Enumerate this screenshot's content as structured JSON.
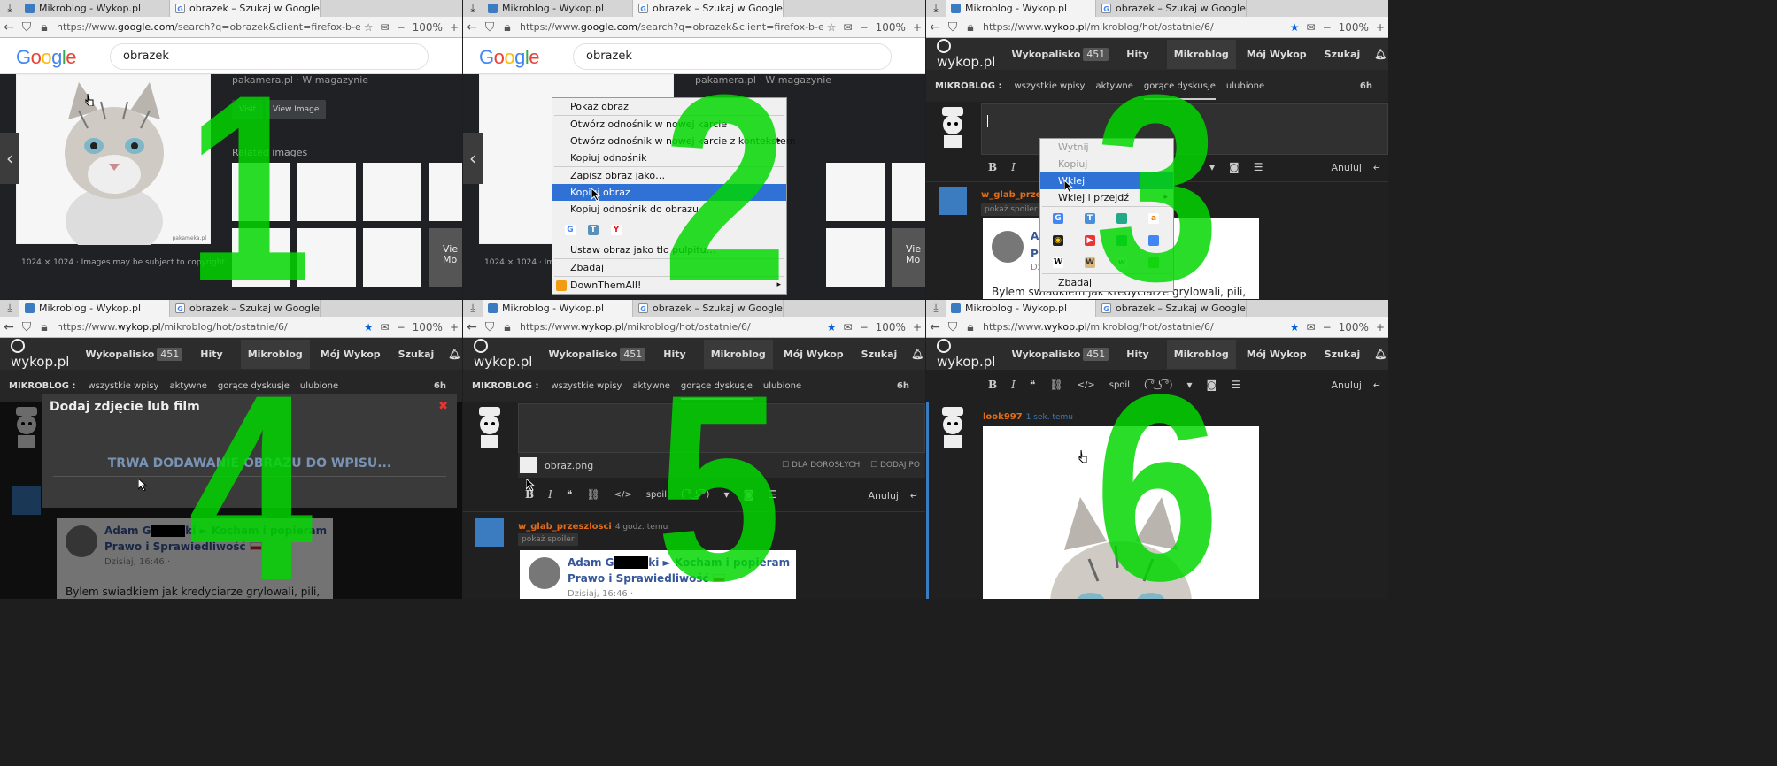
{
  "browser": {
    "tab_wykop": "Mikroblog - Wykop.pl",
    "tab_google": "obrazek – Szukaj w Google",
    "zoom": "100%",
    "url_google_prefix": "https://www.",
    "url_google_host": "google.com",
    "url_google_rest": "/search?q=obrazek&client=firefox-b-e&s",
    "url_wykop_prefix": "https://www.",
    "url_wykop_host": "wykop.pl",
    "url_wykop_rest": "/mikroblog/hot/ostatnie/6/"
  },
  "step_numbers": [
    "1",
    "2",
    "3",
    "4",
    "5",
    "6"
  ],
  "google": {
    "logo": "Google",
    "query": "obrazek",
    "source": "pakamera.pl · W magazynie",
    "visit": "Visit",
    "view_image": "View Image",
    "related": "Related images",
    "caption": "1024 × 1024 · Images may be subject to copyright.",
    "more_a": "Vie",
    "more_b": "Mo",
    "watermark": "pakameka.pl"
  },
  "context_menu_2": {
    "items": [
      "Pokaż obraz",
      "Otwórz odnośnik w nowej karcie",
      "Otwórz odnośnik w nowej karcie z kontekstem",
      "Kopiuj odnośnik",
      "Zapisz obraz jako…",
      "Kopiuj obraz",
      "Kopiuj odnośnik do obrazu",
      "Ustaw obraz jako tło pulpitu…",
      "Zbadaj",
      "DownThemAll!"
    ]
  },
  "context_menu_3": {
    "items": [
      "Wytnij",
      "Kopiuj",
      "Wklej",
      "Wklej i przejdź",
      "Zbadaj"
    ]
  },
  "wykop": {
    "logo": "wykop.pl",
    "nav_wykopalisko": "Wykopalisko",
    "nav_count": "451",
    "nav_hity": "Hity",
    "nav_mikroblog": "Mikroblog",
    "nav_moj": "Mój Wykop",
    "nav_szukaj": "Szukaj",
    "sub_label": "MIKROBLOG :",
    "sub_all": "wszystkie wpisy",
    "sub_active": "aktywne",
    "sub_hot": "gorące dyskusje",
    "sub_fav": "ulubione",
    "sub_time": "6h",
    "anuluj": "Anuluj",
    "spoil": "spoil",
    "lenny": "( ͡° ͜ʖ ͡°)",
    "post_user": "w_glab_przeszlosci",
    "post_time": "4 godz. temu",
    "spoiler": "pokaż spoiler",
    "card_author_a": "Adam G",
    "card_author_b": "ki",
    "card_title": "► Kocham i popieram",
    "card_party": "Prawo i Sprawiedliwość",
    "card_date": "Dzisiaj, 16:46 ·",
    "card_text": "Bylem swiadkiem jak kredyciarze grylowali, pili,",
    "modal_title": "Dodaj zdjęcie lub film",
    "modal_progress": "TRWA DODAWANIE OBRAZU DO WPISU...",
    "attach_name": "obraz.png",
    "adult": "DLA DOROSŁYCH",
    "add_po": "DODAJ PO",
    "new_user": "look997",
    "new_time": "1 sek. temu"
  }
}
